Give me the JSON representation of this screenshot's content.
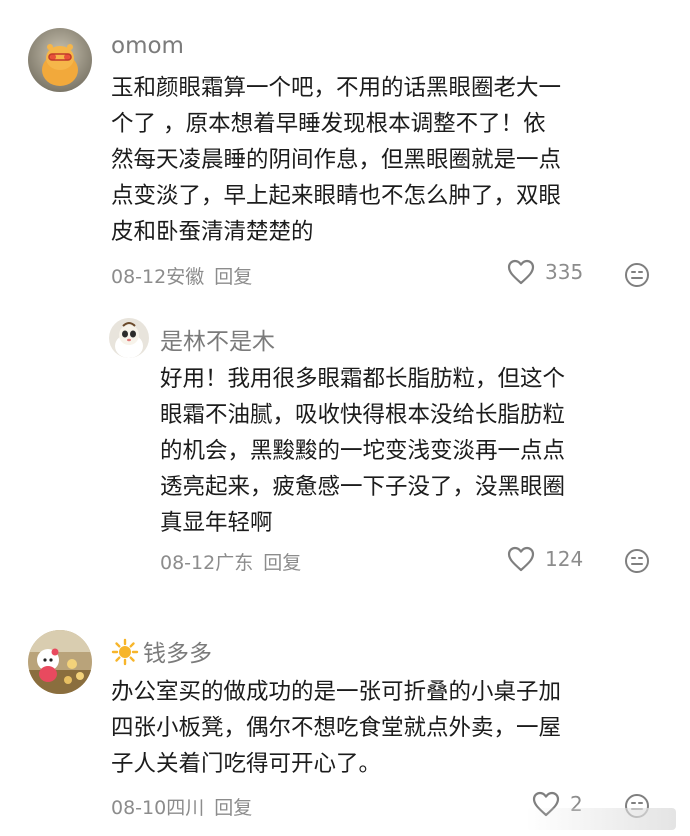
{
  "comments": [
    {
      "username": "omom",
      "text_lines": [
        "玉和颜眼霜算一个吧，不用的话黑眼圈老大一",
        "个了 ，原本想着早睡发现根本调整不了！依",
        "然每天凌晨睡的阴间作息，但黑眼圈就是一点",
        "点变淡了，早上起来眼睛也不怎么肿了，双眼",
        "皮和卧蚕清清楚楚的"
      ],
      "date": "08-12",
      "location": "安徽",
      "reply_label": "回复",
      "likes": "335"
    },
    {
      "username": "是林不是木",
      "text_lines": [
        "好用！我用很多眼霜都长脂肪粒，但这个",
        "眼霜不油腻，吸收快得根本没给长脂肪粒",
        "的机会，黑黢黢的一坨变浅变淡再一点点",
        "透亮起来，疲惫感一下子没了，没黑眼圈",
        "真显年轻啊"
      ],
      "date": "08-12",
      "location": "广东",
      "reply_label": "回复",
      "likes": "124"
    },
    {
      "username": "钱多多",
      "text_lines": [
        "办公室买的做成功的是一张可折叠的小桌子加",
        "四张小板凳，偶尔不想吃食堂就点外卖，一屋",
        "子人关着门吃得可开心了。"
      ],
      "date": "08-10",
      "location": "四川",
      "reply_label": "回复",
      "likes": "2"
    }
  ],
  "icons": {
    "like": "heart-outline-icon",
    "emoji": "smiley-face-icon",
    "username_badge": "sun-emoji-icon"
  },
  "colors": {
    "username": "#7b7b7b",
    "meta": "#8c8c8c",
    "text": "#1c1c1c",
    "sun": "#f7b52a"
  }
}
